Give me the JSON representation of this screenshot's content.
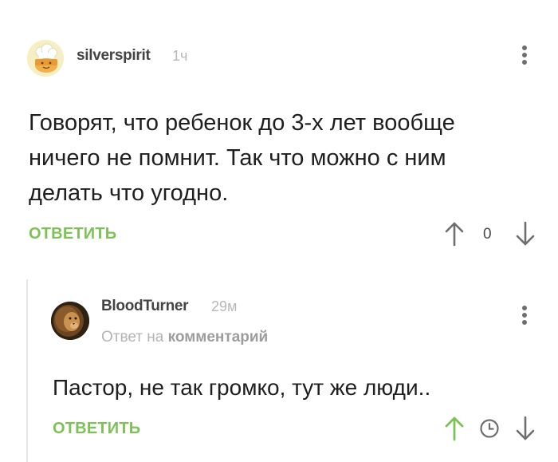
{
  "comments": [
    {
      "username": "silverspirit",
      "time": "1ч",
      "text": "Говорят, что ребенок до 3-х лет вообще ничего не помнит. Так что можно с ним делать что угодно.",
      "reply_label": "ОТВЕТИТЬ",
      "score": "0",
      "avatar_icon": "chef-hat-avatar"
    },
    {
      "username": "BloodTurner",
      "time": "29м",
      "reply_to_prefix": "Ответ на",
      "reply_to_target": "комментарий",
      "text": "Пастор, не так громко, тут же люди..",
      "reply_label": "ОТВЕТИТЬ",
      "avatar_icon": "lion-avatar",
      "upvoted": true
    }
  ],
  "icons": {
    "more": "more-vertical-icon",
    "upvote": "arrow-up-icon",
    "downvote": "arrow-down-icon",
    "clock": "clock-icon"
  },
  "colors": {
    "accent_green": "#7ec157",
    "muted_text": "#b8b8b8",
    "body_text": "#1f1f1f",
    "icon_gray": "#6e6e6e"
  }
}
